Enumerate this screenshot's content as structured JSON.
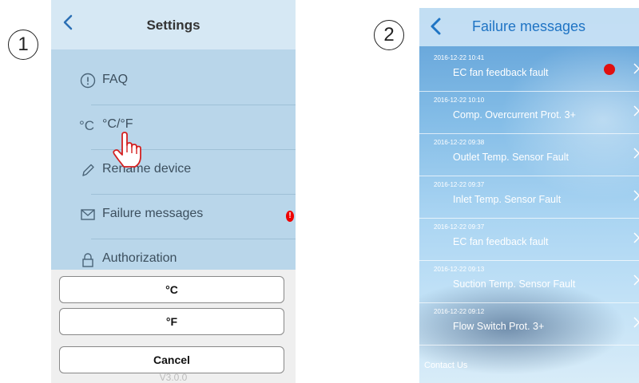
{
  "steps": [
    "1",
    "2"
  ],
  "settings": {
    "title": "Settings",
    "items": [
      {
        "label": "FAQ",
        "icon": "info-circle-icon"
      },
      {
        "label": "°C/°F",
        "icon": "celsius-icon",
        "icon_text": "°C"
      },
      {
        "label": "Rename device",
        "icon": "pencil-icon"
      },
      {
        "label": "Failure messages",
        "icon": "envelope-icon",
        "badge": "!"
      },
      {
        "label": "Authorization",
        "icon": "lock-icon"
      }
    ],
    "sheet": {
      "option_c": "°C",
      "option_f": "°F",
      "cancel": "Cancel"
    },
    "version": "V3.0.0"
  },
  "failures": {
    "title": "Failure messages",
    "rows": [
      {
        "time": "2016-12-22 10:41",
        "message": "EC fan feedback fault",
        "alert": true
      },
      {
        "time": "2016-12-22 10:10",
        "message": "Comp. Overcurrent Prot. 3+"
      },
      {
        "time": "2016-12-22 09:38",
        "message": "Outlet Temp. Sensor Fault"
      },
      {
        "time": "2016-12-22 09:37",
        "message": "Inlet Temp. Sensor Fault"
      },
      {
        "time": "2016-12-22 09:37",
        "message": "EC fan feedback fault"
      },
      {
        "time": "2016-12-22 09:13",
        "message": "Suction Temp. Sensor Fault"
      },
      {
        "time": "2016-12-22 09:12",
        "message": "Flow Switch Prot. 3+"
      }
    ],
    "contact": "Contact Us"
  },
  "colors": {
    "alert": "#e00000",
    "title_blue": "#1f74c4",
    "settings_bg": "#bfd9eb"
  }
}
